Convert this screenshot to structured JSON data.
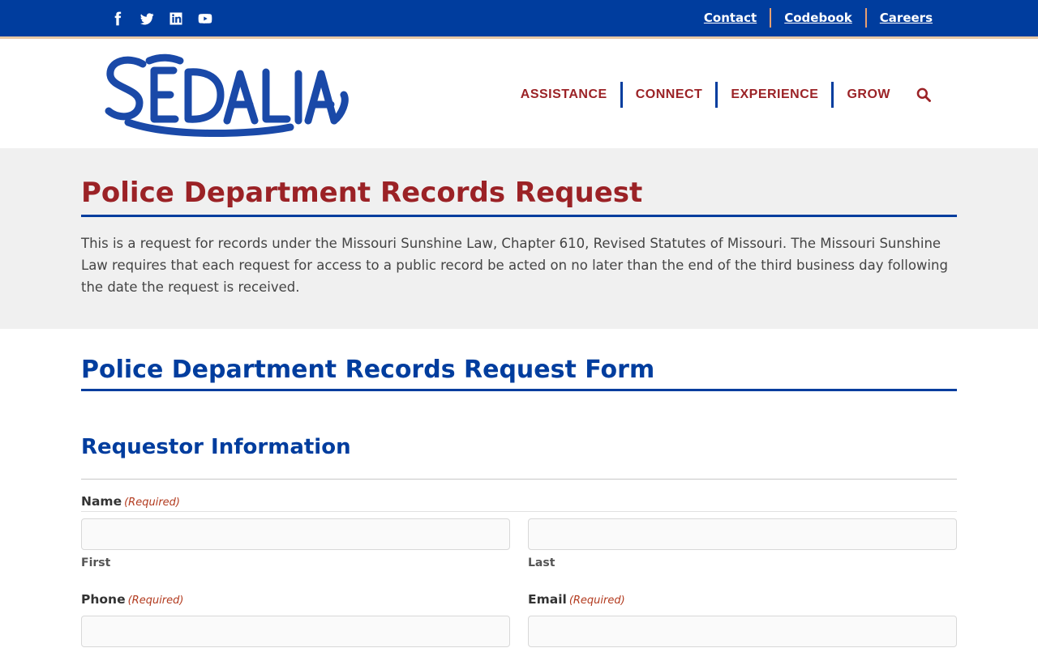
{
  "topbar": {
    "social": [
      {
        "name": "facebook-icon"
      },
      {
        "name": "twitter-icon"
      },
      {
        "name": "linkedin-icon"
      },
      {
        "name": "youtube-icon"
      }
    ],
    "links": [
      "Contact",
      "Codebook",
      "Careers"
    ]
  },
  "header": {
    "logo_text": "SEDALIA",
    "nav": [
      "ASSISTANCE",
      "CONNECT",
      "EXPERIENCE",
      "GROW"
    ],
    "search_icon": "search-icon"
  },
  "intro": {
    "title": "Police Department Records Request",
    "body": "This is a request for records under the Missouri Sunshine Law, Chapter 610, Revised Statutes of Missouri. The Missouri Sunshine Law requires that each request for access to a public record be acted on no later than the end of the third business day following the date the request is received."
  },
  "form": {
    "title": "Police Department Records Request Form",
    "section": "Requestor Information",
    "required_text": "(Required)",
    "name_label": "Name",
    "first_label": "First",
    "last_label": "Last",
    "phone_label": "Phone",
    "email_label": "Email",
    "first_value": "",
    "last_value": "",
    "phone_value": "",
    "email_value": ""
  },
  "colors": {
    "brand_blue": "#003d9e",
    "brand_red": "#9b2226",
    "accent_tan": "#e8a070"
  }
}
